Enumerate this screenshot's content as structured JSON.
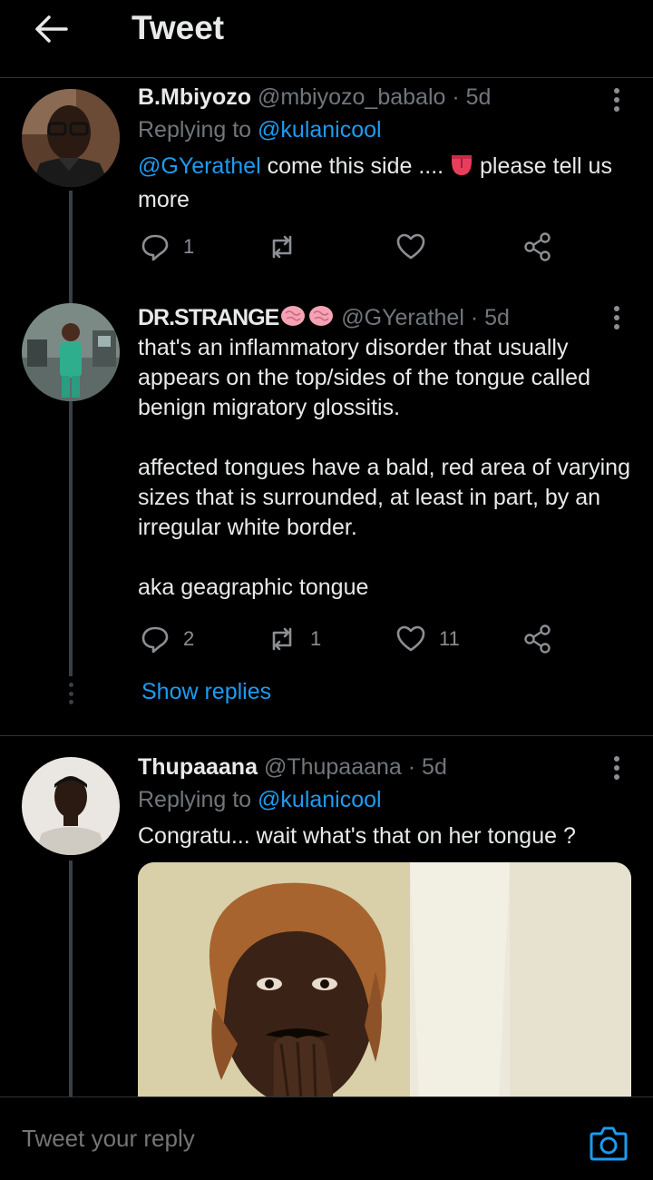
{
  "header": {
    "title": "Tweet",
    "back_icon": "arrow-left-icon"
  },
  "tweets": [
    {
      "display_name": "B.Mbiyozo",
      "handle": "@mbiyozo_babalo",
      "time": "· 5d",
      "replying_prefix": "Replying to ",
      "replying_to": "@kulanicool",
      "mention": "@GYerathel",
      "text_a": " come this side .... ",
      "emoji_icon": "tongue-emoji-icon",
      "text_b": " please tell us more",
      "reply_count": "1",
      "retweet_count": "",
      "like_count": ""
    },
    {
      "display_name": "DR.STRANGE",
      "name_emoji_icon": "brain-emoji-icon",
      "handle": "@GYerathel",
      "time": "· 5d",
      "paragraph_1": "that's an inflammatory disorder that usually appears on the top/sides of the tongue called benign migratory glossitis.",
      "paragraph_2": "affected tongues have a bald, red area of varying sizes that is surrounded, at least in part, by an irregular white border.",
      "paragraph_3": "aka geagraphic tongue",
      "reply_count": "2",
      "retweet_count": "1",
      "like_count": "11"
    },
    {
      "display_name": "Thupaaana",
      "handle": "@Thupaaana",
      "time": "· 5d",
      "replying_prefix": "Replying to ",
      "replying_to": "@kulanicool",
      "text": "Congratu... wait what's that on her tongue ?"
    }
  ],
  "show_replies_label": "Show replies",
  "reply_bar": {
    "placeholder": "Tweet your reply",
    "camera_icon": "camera-icon"
  },
  "colors": {
    "background": "#000000",
    "accent": "#1d9bf0",
    "secondary_text": "#71767b",
    "divider": "#2f3336"
  }
}
